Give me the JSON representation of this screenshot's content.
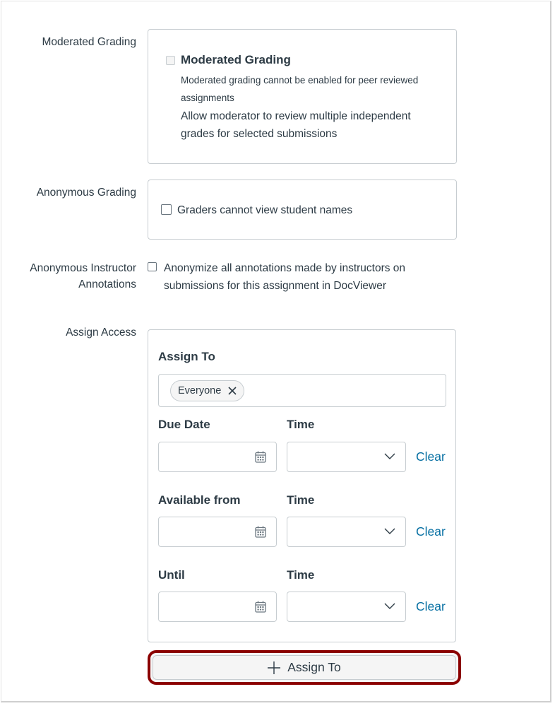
{
  "moderated_grading": {
    "label": "Moderated Grading",
    "checkbox_label": "Moderated Grading",
    "checked": false,
    "disabled": true,
    "warning_line1": "Moderated grading cannot be enabled for peer reviewed",
    "warning_line2": "assignments",
    "description_line1": "Allow moderator to review multiple independent",
    "description_line2": "grades for selected submissions"
  },
  "anonymous_grading": {
    "label": "Anonymous Grading",
    "checkbox_label": "Graders cannot view student names",
    "checked": false
  },
  "anonymous_annotations": {
    "label_line1": "Anonymous Instructor",
    "label_line2": "Annotations",
    "checkbox_label_line1": "Anonymize all annotations made by instructors on",
    "checkbox_label_line2": "submissions for this assignment in DocViewer",
    "checked": false
  },
  "assign_access": {
    "label": "Assign Access",
    "assign_to_label": "Assign To",
    "assignees": [
      "Everyone"
    ],
    "rows": [
      {
        "date_label": "Due Date",
        "time_label": "Time",
        "date_value": "",
        "time_value": "",
        "clear_label": "Clear"
      },
      {
        "date_label": "Available from",
        "time_label": "Time",
        "date_value": "",
        "time_value": "",
        "clear_label": "Clear"
      },
      {
        "date_label": "Until",
        "time_label": "Time",
        "date_value": "",
        "time_value": "",
        "clear_label": "Clear"
      }
    ],
    "add_button_label": "Assign To"
  },
  "colors": {
    "link": "#0770a3",
    "text": "#2d3b45",
    "border": "#c7cdd1",
    "highlight": "#8b0000"
  }
}
